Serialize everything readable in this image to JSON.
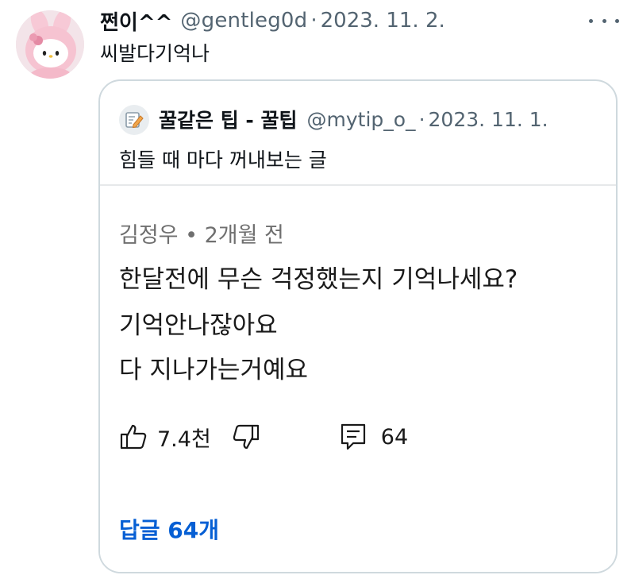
{
  "tweet": {
    "display_name": "쩐이^^",
    "handle": "@gentleg0d",
    "separator": "·",
    "date": "2023. 11. 2.",
    "text": "씨발다기억나",
    "avatar_icon": "hello-kitty-avatar"
  },
  "quoted_tweet": {
    "display_name": "꿀같은 팁 - 꿀팁",
    "handle": "@mytip_o_",
    "separator": "·",
    "date": "2023. 11. 1.",
    "text": "힘들 때 마다 꺼내보는 글",
    "avatar_icon": "memo-pencil-icon"
  },
  "comment_image": {
    "author_meta": "김정우 • 2개월 전",
    "lines": [
      "한달전에 무슨 걱정했는지 기억나세요?",
      "기억안나잖아요",
      "다 지나가는거예요"
    ],
    "like_count": "7.4천",
    "reply_count": "64",
    "replies_link": "답글 64개"
  },
  "colors": {
    "text_primary": "#0f1419",
    "text_secondary": "#536471",
    "border": "#cfd9de",
    "link_blue": "#065fd4"
  }
}
